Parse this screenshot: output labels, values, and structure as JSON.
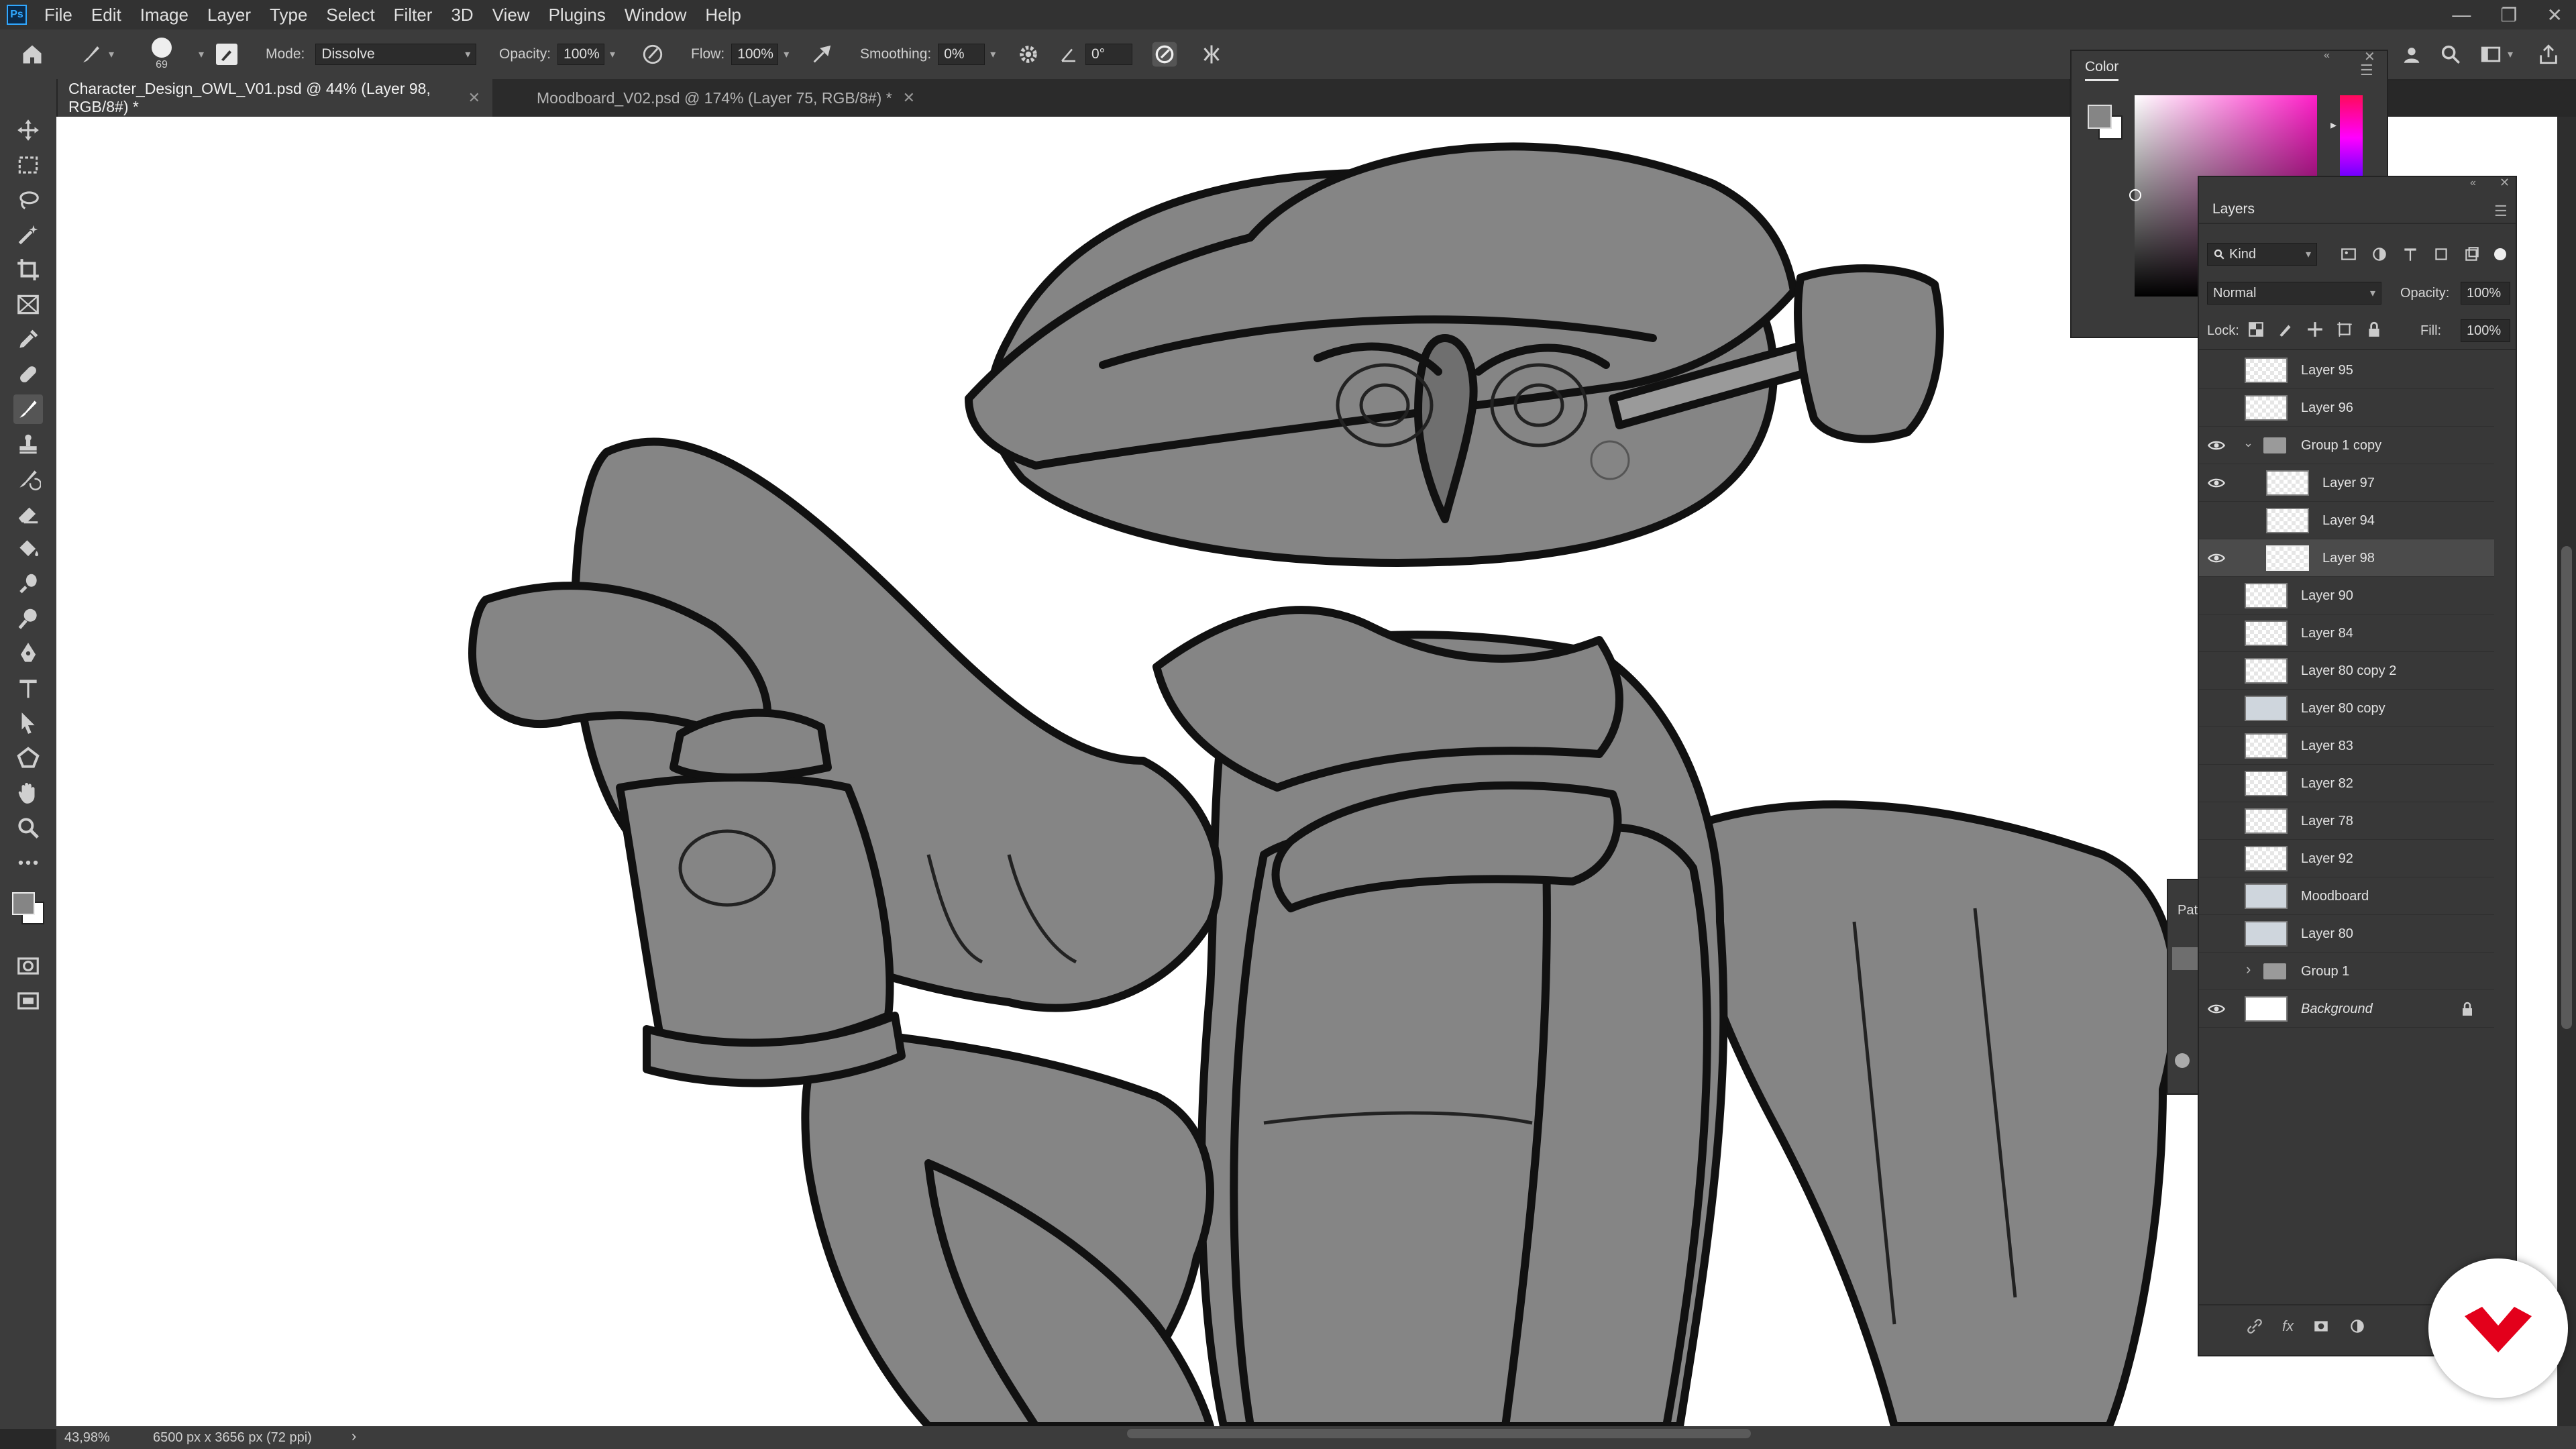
{
  "menubar": {
    "logo": "Ps",
    "items": [
      "File",
      "Edit",
      "Image",
      "Layer",
      "Type",
      "Select",
      "Filter",
      "3D",
      "View",
      "Plugins",
      "Window",
      "Help"
    ]
  },
  "options": {
    "brush_size": "69",
    "mode_label": "Mode:",
    "mode_value": "Dissolve",
    "opacity_label": "Opacity:",
    "opacity_value": "100%",
    "flow_label": "Flow:",
    "flow_value": "100%",
    "smoothing_label": "Smoothing:",
    "smoothing_value": "0%",
    "angle_value": "0°"
  },
  "tabs": [
    {
      "label": "Character_Design_OWL_V01.psd @ 44% (Layer 98, RGB/8#) *"
    },
    {
      "label": "Moodboard_V02.psd @ 174% (Layer 75, RGB/8#) *"
    }
  ],
  "status": {
    "zoom": "43,98%",
    "doc_size": "6500 px x 3656 px (72 ppi)"
  },
  "color_panel": {
    "title": "Color"
  },
  "paths_stub": {
    "label": "Pat"
  },
  "layers_panel": {
    "title": "Layers",
    "filter_kind": "Kind",
    "blend_mode": "Normal",
    "opacity_label": "Opacity:",
    "opacity_value": "100%",
    "lock_label": "Lock:",
    "fill_label": "Fill:",
    "fill_value": "100%",
    "layers": [
      {
        "name": "Layer 95",
        "visible": false,
        "kind": "layer",
        "indent": false,
        "selected": false
      },
      {
        "name": "Layer 96",
        "visible": false,
        "kind": "layer",
        "indent": false,
        "selected": false
      },
      {
        "name": "Group 1 copy",
        "visible": true,
        "kind": "group-open",
        "indent": false,
        "selected": false
      },
      {
        "name": "Layer 97",
        "visible": true,
        "kind": "layer",
        "indent": true,
        "selected": false
      },
      {
        "name": "Layer 94",
        "visible": false,
        "kind": "layer",
        "indent": true,
        "selected": false
      },
      {
        "name": "Layer 98",
        "visible": true,
        "kind": "layer",
        "indent": true,
        "selected": true
      },
      {
        "name": "Layer 90",
        "visible": false,
        "kind": "layer",
        "indent": false,
        "selected": false
      },
      {
        "name": "Layer 84",
        "visible": false,
        "kind": "layer",
        "indent": false,
        "selected": false
      },
      {
        "name": "Layer 80 copy 2",
        "visible": false,
        "kind": "layer",
        "indent": false,
        "selected": false
      },
      {
        "name": "Layer 80 copy",
        "visible": false,
        "kind": "image",
        "indent": false,
        "selected": false
      },
      {
        "name": "Layer 83",
        "visible": false,
        "kind": "layer",
        "indent": false,
        "selected": false
      },
      {
        "name": "Layer 82",
        "visible": false,
        "kind": "layer",
        "indent": false,
        "selected": false
      },
      {
        "name": "Layer 78",
        "visible": false,
        "kind": "layer",
        "indent": false,
        "selected": false
      },
      {
        "name": "Layer 92",
        "visible": false,
        "kind": "layer",
        "indent": false,
        "selected": false
      },
      {
        "name": "Moodboard",
        "visible": false,
        "kind": "image",
        "indent": false,
        "selected": false
      },
      {
        "name": "Layer 80",
        "visible": false,
        "kind": "image",
        "indent": false,
        "selected": false
      },
      {
        "name": "Group 1",
        "visible": false,
        "kind": "group-closed",
        "indent": false,
        "selected": false
      },
      {
        "name": "Background",
        "visible": true,
        "kind": "background",
        "indent": false,
        "selected": false
      }
    ]
  },
  "colors": {
    "ui_dark": "#323232",
    "sketch_fill": "#858585",
    "brand_red": "#e3001b"
  }
}
